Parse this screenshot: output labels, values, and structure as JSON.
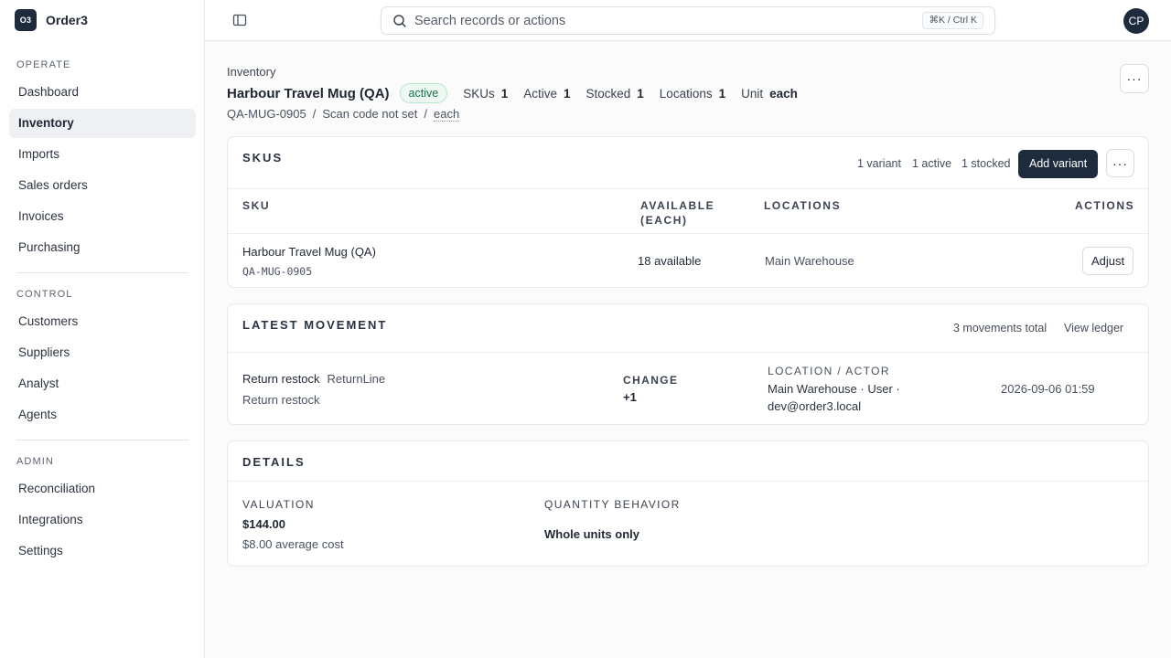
{
  "app": {
    "logo": "O3",
    "name": "Order3"
  },
  "sidebar": {
    "sections": [
      {
        "label": "OPERATE",
        "items": [
          "Dashboard",
          "Inventory",
          "Imports",
          "Sales orders",
          "Invoices",
          "Purchasing"
        ]
      },
      {
        "label": "CONTROL",
        "items": [
          "Customers",
          "Suppliers",
          "Analyst",
          "Agents"
        ]
      },
      {
        "label": "ADMIN",
        "items": [
          "Reconciliation",
          "Integrations",
          "Settings"
        ]
      }
    ],
    "active": "Inventory"
  },
  "topbar": {
    "search_placeholder": "Search records or actions",
    "shortcut": "⌘K / Ctrl K",
    "avatar": "CP"
  },
  "page": {
    "breadcrumb": "Inventory",
    "title": "Harbour Travel Mug (QA)",
    "status": "active",
    "stats": [
      {
        "label": "SKUs",
        "value": "1"
      },
      {
        "label": "Active",
        "value": "1"
      },
      {
        "label": "Stocked",
        "value": "1"
      },
      {
        "label": "Locations",
        "value": "1"
      },
      {
        "label": "Unit",
        "value": "each"
      }
    ],
    "sku_code": "QA-MUG-0905",
    "scan_code": "Scan code not set",
    "unit": "each",
    "sep": "/",
    "more": "···"
  },
  "skus": {
    "title": "SKUS",
    "meta": [
      "1 variant",
      "1 active",
      "1 stocked"
    ],
    "add_label": "Add variant",
    "columns": {
      "sku": "SKU",
      "available": "AVAILABLE (EACH)",
      "locations": "LOCATIONS",
      "actions": "ACTIONS"
    },
    "rows": [
      {
        "name": "Harbour Travel Mug (QA)",
        "code": "QA-MUG-0905",
        "available": "18 available",
        "location": "Main Warehouse",
        "action": "Adjust"
      }
    ]
  },
  "movement": {
    "title": "LATEST MOVEMENT",
    "total": "3 movements total",
    "view_ledger": "View ledger",
    "type": "Return restock",
    "source": "ReturnLine",
    "note": "Return restock",
    "change_label": "CHANGE",
    "change_value": "+1",
    "location_label": "LOCATION / ACTOR",
    "location_line1": "Main Warehouse · User ·",
    "location_line2": "dev@order3.local",
    "timestamp": "2026-09-06 01:59"
  },
  "details": {
    "title": "DETAILS",
    "valuation_label": "VALUATION",
    "valuation_value": "$144.00",
    "valuation_note": "$8.00 average cost",
    "qty_label": "QUANTITY BEHAVIOR",
    "qty_value": "Whole units only"
  }
}
